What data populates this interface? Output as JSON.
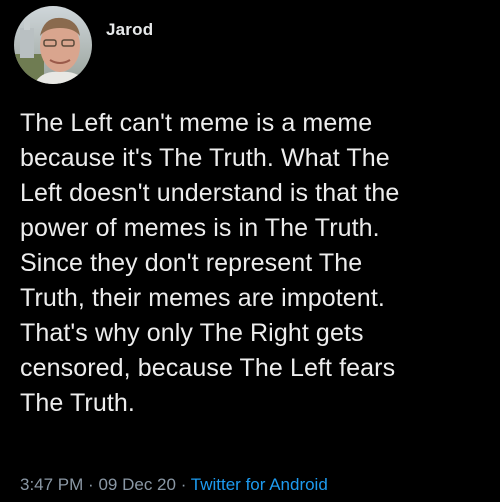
{
  "tweet": {
    "author_name": "Jarod",
    "text_lines": [
      "The Left can't meme is a meme",
      "because it's The Truth. What The",
      "Left doesn't understand is that the",
      "power of memes is in The Truth.",
      "Since they don't represent The",
      "Truth, their memes are impotent.",
      "That's why only The Right gets",
      "censored, because The Left fears",
      "The Truth."
    ],
    "time": "3:47 PM",
    "separator": "·",
    "date": "09 Dec 20",
    "source": "Twitter for Android"
  },
  "colors": {
    "background": "#000000",
    "text": "#ededed",
    "meta_text": "#8b98a5",
    "link": "#1d9bf0"
  }
}
